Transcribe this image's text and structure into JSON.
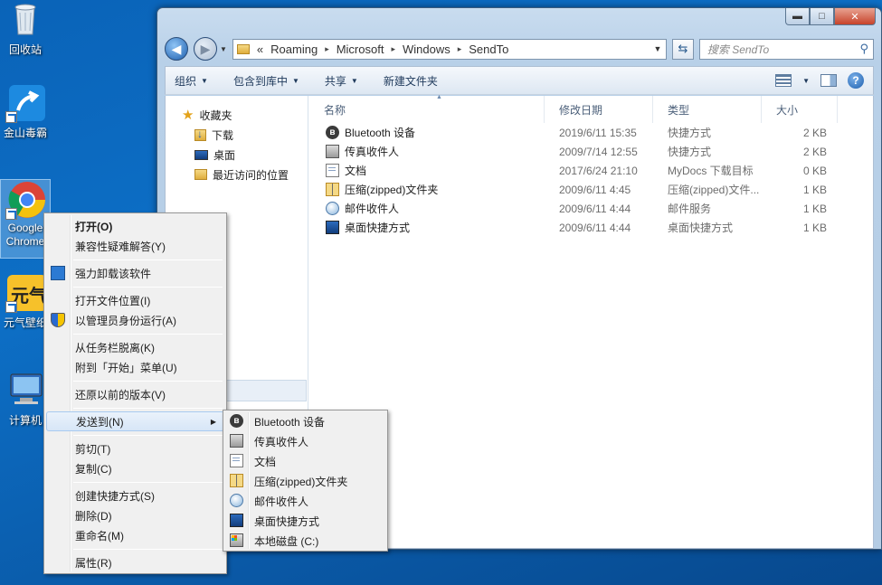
{
  "desktop": {
    "icons": [
      {
        "label": "回收站",
        "icon": "recycle-bin-icon"
      },
      {
        "label": "金山毒霸",
        "icon": "kingsoft-antivirus-icon"
      },
      {
        "label": "Google Chrome",
        "icon": "chrome-icon"
      },
      {
        "label": "元气壁纸",
        "icon": "yuanqi-wallpaper-icon"
      },
      {
        "label": "计算机",
        "icon": "computer-icon"
      }
    ]
  },
  "window": {
    "caption_buttons": {
      "minimize": "▬",
      "maximize": "□",
      "close": "✕"
    },
    "address": {
      "prefix": "«",
      "crumbs": [
        "Roaming",
        "Microsoft",
        "Windows",
        "SendTo"
      ],
      "separator": "▸"
    },
    "search_placeholder": "搜索 SendTo",
    "toolbar": {
      "organize": "组织",
      "include_in_library": "包含到库中",
      "share": "共享",
      "new_folder": "新建文件夹"
    },
    "nav": {
      "favorites": "收藏夹",
      "items": [
        "下载",
        "桌面",
        "最近访问的位置"
      ]
    },
    "columns": {
      "name": "名称",
      "date": "修改日期",
      "type": "类型",
      "size": "大小"
    },
    "files": [
      {
        "name": "Bluetooth 设备",
        "date": "2019/6/11 15:35",
        "type": "快捷方式",
        "size": "2 KB",
        "icon": "bluetooth-icon"
      },
      {
        "name": "传真收件人",
        "date": "2009/7/14 12:55",
        "type": "快捷方式",
        "size": "2 KB",
        "icon": "fax-icon"
      },
      {
        "name": "文档",
        "date": "2017/6/24 21:10",
        "type": "MyDocs 下载目标",
        "size": "0 KB",
        "icon": "document-icon"
      },
      {
        "name": "压缩(zipped)文件夹",
        "date": "2009/6/11 4:45",
        "type": "压缩(zipped)文件...",
        "size": "1 KB",
        "icon": "zip-folder-icon"
      },
      {
        "name": "邮件收件人",
        "date": "2009/6/11 4:44",
        "type": "邮件服务",
        "size": "1 KB",
        "icon": "mail-recipient-icon"
      },
      {
        "name": "桌面快捷方式",
        "date": "2009/6/11 4:44",
        "type": "桌面快捷方式",
        "size": "1 KB",
        "icon": "desktop-shortcut-icon"
      }
    ]
  },
  "context_menu": {
    "open": "打开(O)",
    "compat": "兼容性疑难解答(Y)",
    "uninstall": "强力卸载该软件",
    "open_location": "打开文件位置(I)",
    "run_as_admin": "以管理员身份运行(A)",
    "unpin_taskbar": "从任务栏脱离(K)",
    "pin_start": "附到「开始」菜单(U)",
    "restore_prev": "还原以前的版本(V)",
    "send_to": "发送到(N)",
    "cut": "剪切(T)",
    "copy": "复制(C)",
    "create_shortcut": "创建快捷方式(S)",
    "delete": "删除(D)",
    "rename": "重命名(M)",
    "properties": "属性(R)"
  },
  "send_to_menu": [
    {
      "label": "Bluetooth 设备",
      "icon": "bluetooth-icon"
    },
    {
      "label": "传真收件人",
      "icon": "fax-icon"
    },
    {
      "label": "文档",
      "icon": "document-icon"
    },
    {
      "label": "压缩(zipped)文件夹",
      "icon": "zip-folder-icon"
    },
    {
      "label": "邮件收件人",
      "icon": "mail-recipient-icon"
    },
    {
      "label": "桌面快捷方式",
      "icon": "desktop-shortcut-icon"
    },
    {
      "label": "本地磁盘 (C:)",
      "icon": "local-disk-icon"
    }
  ]
}
